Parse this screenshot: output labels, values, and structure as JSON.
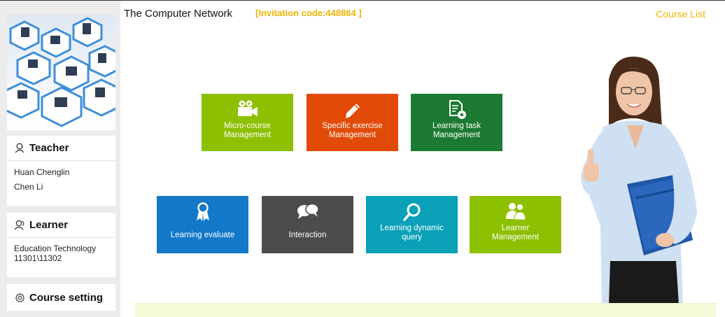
{
  "header": {
    "course_title": "The Computer Network",
    "invitation": "[Invitation code:448864 ]",
    "course_list_label": "Course List"
  },
  "sidebar": {
    "teacher": {
      "title": "Teacher",
      "icon": "person-icon",
      "names": [
        "Huan  Chenglin",
        "Chen  Li"
      ]
    },
    "learner": {
      "title": "Learner",
      "icon": "group-icon",
      "lines": [
        "Education Technology",
        "11301\\11302"
      ]
    },
    "course_setting": {
      "title": "Course setting",
      "icon": "gear-icon"
    }
  },
  "tiles": {
    "micro": {
      "label1": "Micro-course",
      "label2": "Management",
      "icon": "video-camera-icon",
      "color": "#8dc000"
    },
    "exercise": {
      "label1": "Specific exercise",
      "label2": "Management",
      "icon": "pencil-icon",
      "color": "#e24a07"
    },
    "task": {
      "label1": "Learning task",
      "label2": "Management",
      "icon": "document-icon",
      "color": "#1d7a32"
    },
    "evaluate": {
      "label1": "Learning evaluate",
      "icon": "ribbon-icon",
      "color": "#1478c8"
    },
    "interaction": {
      "label1": "Interaction",
      "icon": "chat-bubbles-icon",
      "color": "#4c4c4c"
    },
    "query": {
      "label1": "Learning dynamic",
      "label2": "query",
      "icon": "magnifier-icon",
      "color": "#0aa1b8"
    },
    "learner_mgmt": {
      "label1": "Learner",
      "label2": "Management",
      "icon": "people-icon",
      "color": "#8dc000"
    }
  },
  "accent_color": "#f0b400"
}
